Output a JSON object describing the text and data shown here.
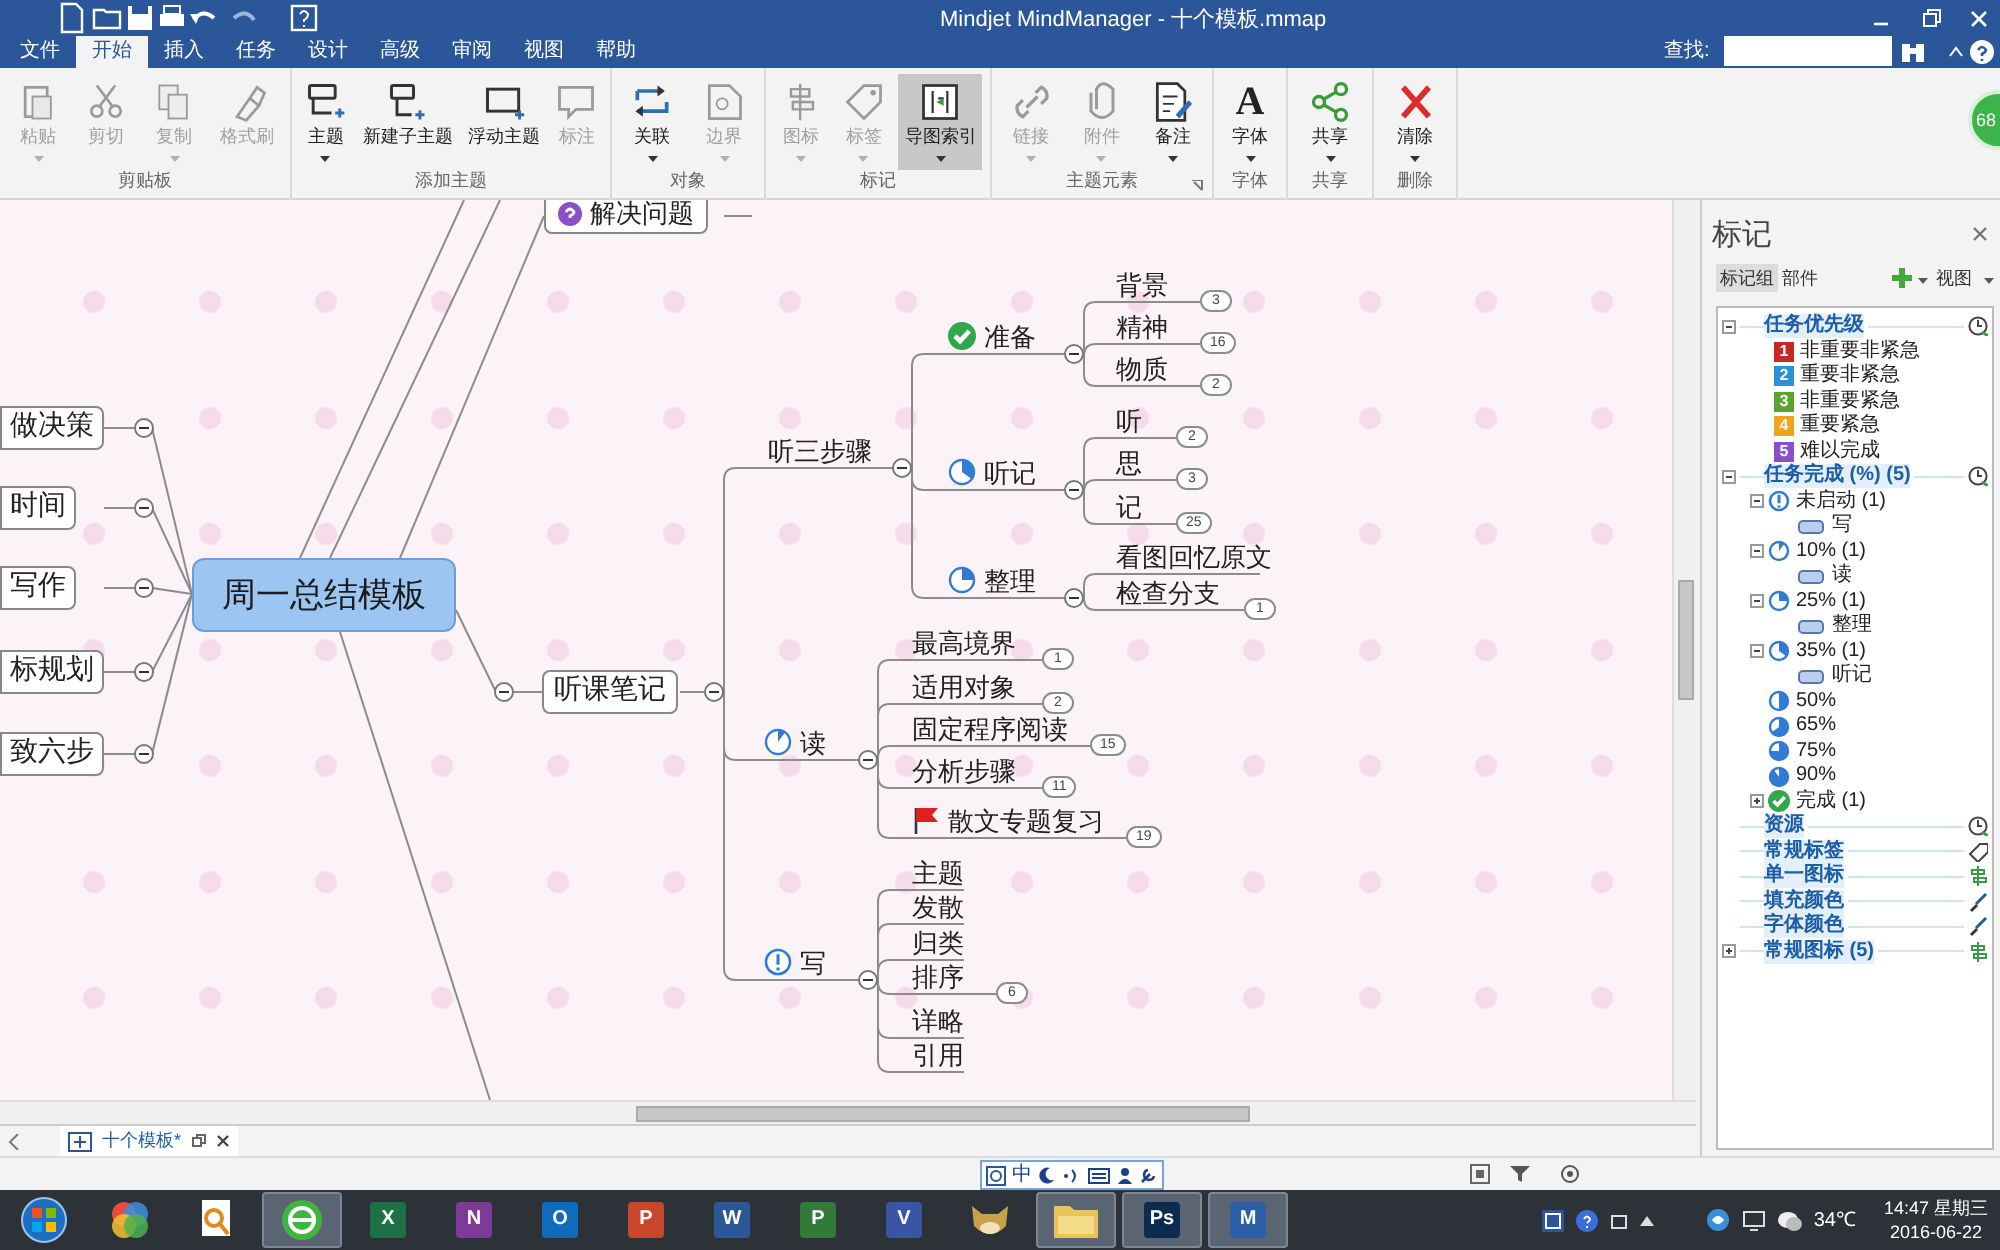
{
  "window": {
    "title": "Mindjet MindManager - 十个模板.mmap"
  },
  "menu_tabs": [
    {
      "label": "文件",
      "selected": false
    },
    {
      "label": "开始",
      "selected": true
    },
    {
      "label": "插入",
      "selected": false
    },
    {
      "label": "任务",
      "selected": false
    },
    {
      "label": "设计",
      "selected": false
    },
    {
      "label": "高级",
      "selected": false
    },
    {
      "label": "审阅",
      "selected": false
    },
    {
      "label": "视图",
      "selected": false
    },
    {
      "label": "帮助",
      "selected": false
    }
  ],
  "search": {
    "label": "查找:"
  },
  "badge": "68",
  "ribbon": {
    "groups": [
      {
        "label": "剪贴板",
        "buttons": [
          {
            "label": "粘贴",
            "disabled": true,
            "dropdown": true,
            "pressed": false
          },
          {
            "label": "剪切",
            "disabled": true,
            "dropdown": false,
            "pressed": false
          },
          {
            "label": "复制",
            "disabled": true,
            "dropdown": true,
            "pressed": false
          },
          {
            "label": "格式刷",
            "disabled": true,
            "dropdown": false,
            "pressed": false
          }
        ]
      },
      {
        "label": "添加主题",
        "buttons": [
          {
            "label": "主题",
            "disabled": false,
            "dropdown": true,
            "pressed": false
          },
          {
            "label": "新建子主题",
            "disabled": false,
            "dropdown": false,
            "pressed": false
          },
          {
            "label": "浮动主题",
            "disabled": false,
            "dropdown": false,
            "pressed": false
          },
          {
            "label": "标注",
            "disabled": true,
            "dropdown": false,
            "pressed": false
          }
        ]
      },
      {
        "label": "对象",
        "buttons": [
          {
            "label": "关联",
            "disabled": false,
            "dropdown": true,
            "pressed": false
          },
          {
            "label": "边界",
            "disabled": true,
            "dropdown": true,
            "pressed": false
          }
        ]
      },
      {
        "label": "标记",
        "buttons": [
          {
            "label": "图标",
            "disabled": true,
            "dropdown": true,
            "pressed": false
          },
          {
            "label": "标签",
            "disabled": true,
            "dropdown": true,
            "pressed": false
          },
          {
            "label": "导图索引",
            "disabled": false,
            "dropdown": true,
            "pressed": true
          }
        ]
      },
      {
        "label": "主题元素",
        "launcher": true,
        "buttons": [
          {
            "label": "链接",
            "disabled": true,
            "dropdown": true,
            "pressed": false
          },
          {
            "label": "附件",
            "disabled": true,
            "dropdown": true,
            "pressed": false
          },
          {
            "label": "备注",
            "disabled": false,
            "dropdown": true,
            "pressed": false
          }
        ]
      },
      {
        "label": "字体",
        "buttons": [
          {
            "label": "字体",
            "glyph": "A",
            "disabled": false,
            "dropdown": true,
            "pressed": false
          }
        ]
      },
      {
        "label": "共享",
        "buttons": [
          {
            "label": "共享",
            "disabled": false,
            "dropdown": true,
            "pressed": false
          }
        ]
      },
      {
        "label": "删除",
        "buttons": [
          {
            "label": "清除",
            "disabled": false,
            "dropdown": true,
            "pressed": false
          }
        ]
      }
    ]
  },
  "map": {
    "central_topic": "周一总结模板",
    "left_topics": [
      "做决策",
      "时间",
      "写作",
      "标规划",
      "致六步"
    ],
    "top_topic": {
      "label": "解决问题"
    },
    "main_branch": {
      "label": "听课笔记",
      "children": [
        {
          "label": "听三步骤",
          "children": [
            {
              "label": "准备",
              "marker": {
                "kind": "done"
              },
              "children": [
                {
                  "label": "背景",
                  "count": "3"
                },
                {
                  "label": "精神",
                  "count": "16"
                },
                {
                  "label": "物质",
                  "count": "2"
                }
              ]
            },
            {
              "label": "听记",
              "marker": {
                "kind": "pie35"
              },
              "children": [
                {
                  "label": "听",
                  "count": "2"
                },
                {
                  "label": "思",
                  "count": "3"
                },
                {
                  "label": "记",
                  "count": "25"
                }
              ]
            },
            {
              "label": "整理",
              "marker": {
                "kind": "pie25"
              },
              "children": [
                {
                  "label": "看图回忆原文"
                },
                {
                  "label": "检查分支",
                  "count": "1"
                }
              ]
            }
          ]
        },
        {
          "label": "读",
          "marker": {
            "kind": "pie10"
          },
          "children": [
            {
              "label": "最高境界",
              "count": "1"
            },
            {
              "label": "适用对象",
              "count": "2"
            },
            {
              "label": "固定程序阅读",
              "count": "15"
            },
            {
              "label": "分析步骤",
              "count": "11"
            },
            {
              "label": "散文专题复习",
              "count": "19",
              "marker": {
                "kind": "flag"
              }
            }
          ]
        },
        {
          "label": "写",
          "marker": {
            "kind": "not_started"
          },
          "children": [
            {
              "label": "主题"
            },
            {
              "label": "发散"
            },
            {
              "label": "归类"
            },
            {
              "label": "排序",
              "count": "6"
            },
            {
              "label": "详略"
            },
            {
              "label": "引用"
            }
          ]
        }
      ]
    }
  },
  "markers_panel": {
    "title": "标记",
    "tabs": [
      {
        "label": "标记组",
        "selected": true
      },
      {
        "label": "部件",
        "selected": false
      }
    ],
    "view_menu": "视图",
    "groups": [
      {
        "label": "任务优先级",
        "expanded": true,
        "children": [
          {
            "kind": "priority",
            "badge": "1",
            "label": "非重要非紧急",
            "color": "#c62828"
          },
          {
            "kind": "priority",
            "badge": "2",
            "label": "重要非紧急",
            "color": "#2b8fd9"
          },
          {
            "kind": "priority",
            "badge": "3",
            "label": "非重要紧急",
            "color": "#5ba32b"
          },
          {
            "kind": "priority",
            "badge": "4",
            "label": "重要紧急",
            "color": "#f0a31c"
          },
          {
            "kind": "priority",
            "badge": "5",
            "label": "难以完成",
            "color": "#8b4fcc"
          }
        ]
      },
      {
        "label": "任务完成 (%) (5)",
        "expanded": true,
        "children": [
          {
            "kind": "not_started",
            "label": "未启动 (1)",
            "expanded": true,
            "children": [
              {
                "kind": "topic",
                "label": "写"
              }
            ]
          },
          {
            "kind": "pie10",
            "label": "10% (1)",
            "expanded": true,
            "children": [
              {
                "kind": "topic",
                "label": "读"
              }
            ]
          },
          {
            "kind": "pie25",
            "label": "25% (1)",
            "expanded": true,
            "children": [
              {
                "kind": "topic",
                "label": "整理"
              }
            ]
          },
          {
            "kind": "pie35",
            "label": "35% (1)",
            "expanded": true,
            "children": [
              {
                "kind": "topic",
                "label": "听记"
              }
            ]
          },
          {
            "kind": "pie50",
            "label": "50%"
          },
          {
            "kind": "pie65",
            "label": "65%"
          },
          {
            "kind": "pie75",
            "label": "75%"
          },
          {
            "kind": "pie90",
            "label": "90%"
          },
          {
            "kind": "done",
            "label": "完成 (1)",
            "expanded": false
          }
        ]
      },
      {
        "label": "资源"
      },
      {
        "label": "常规标签"
      },
      {
        "label": "单一图标"
      },
      {
        "label": "填充颜色"
      },
      {
        "label": "字体颜色"
      },
      {
        "label": "常规图标 (5)",
        "expanded": false
      }
    ]
  },
  "document_tabs": [
    {
      "label": "十个模板*",
      "selected": true
    }
  ],
  "status_bar": {
    "ime_label": "中"
  },
  "taskbar": {
    "apps": [
      {
        "kind": "orb",
        "active": false
      },
      {
        "kind": "pinwheel",
        "active": false
      },
      {
        "kind": "search_doc",
        "active": false
      },
      {
        "kind": "browser",
        "active": true
      },
      {
        "kind": "tile",
        "glyph": "X",
        "color": "#1e7145",
        "active": false
      },
      {
        "kind": "tile",
        "glyph": "N",
        "color": "#7e3a99",
        "active": false
      },
      {
        "kind": "tile",
        "glyph": "O",
        "color": "#0f6cbd",
        "active": false
      },
      {
        "kind": "tile",
        "glyph": "P",
        "color": "#c8472a",
        "active": false
      },
      {
        "kind": "tile",
        "glyph": "W",
        "color": "#2b5797",
        "active": false
      },
      {
        "kind": "tile",
        "glyph": "P",
        "color": "#317a39",
        "active": false
      },
      {
        "kind": "tile",
        "glyph": "V",
        "color": "#3955a3",
        "active": false
      },
      {
        "kind": "cat",
        "active": false
      },
      {
        "kind": "folder",
        "active": true
      },
      {
        "kind": "tile",
        "glyph": "Ps",
        "color": "#0c2c4f",
        "active": true
      },
      {
        "kind": "tile",
        "glyph": "M",
        "color": "#2c5fa8",
        "active": true
      }
    ]
  },
  "tray": {
    "temperature": "34℃",
    "time": "14:47 星期三",
    "date": "2016-06-22"
  }
}
